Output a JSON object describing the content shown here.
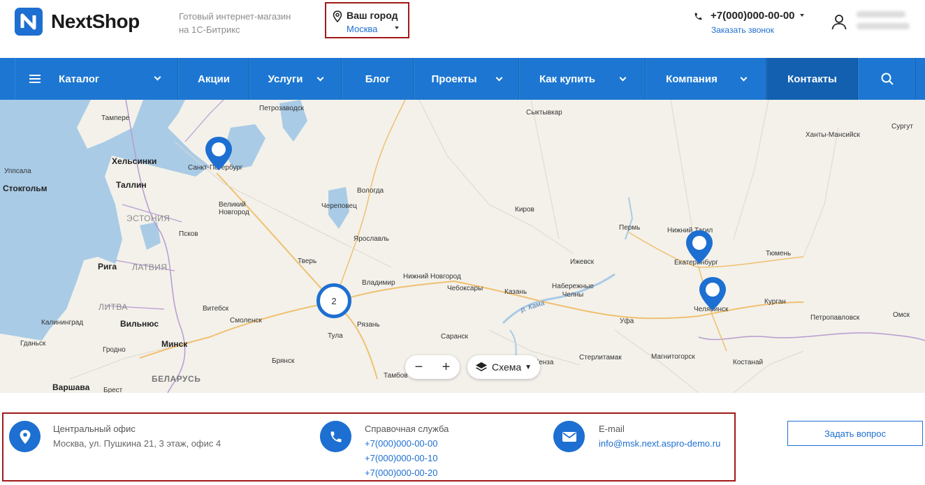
{
  "brand": {
    "name": "NextShop",
    "accent": "#1d6fd1"
  },
  "tagline": {
    "line1": "Готовый интернет-магазин",
    "line2": "на 1С-Битрикс"
  },
  "city": {
    "title": "Ваш город",
    "value": "Москва"
  },
  "phone": {
    "number": "+7(000)000-00-00",
    "callback": "Заказать звонок"
  },
  "nav": {
    "items": [
      {
        "label": "Каталог",
        "has_menu": true
      },
      {
        "label": "Акции"
      },
      {
        "label": "Услуги",
        "has_menu": true
      },
      {
        "label": "Блог"
      },
      {
        "label": "Проекты",
        "has_menu": true
      },
      {
        "label": "Как купить",
        "has_menu": true
      },
      {
        "label": "Компания",
        "has_menu": true
      },
      {
        "label": "Контакты",
        "active": true
      }
    ]
  },
  "map": {
    "cities": [
      "Петрозаводск",
      "Сыктывкар",
      "Тампере",
      "Ханты-Мансийск",
      "Сургут",
      "Хельсинки",
      "Санкт-Петербург",
      "Уппсала",
      "Стокгольм",
      "Таллин",
      "Вологда",
      "Череповец",
      "Великий Новгород",
      "Киров",
      "Пермь",
      "Нижний Тагил",
      "ЭСТОНИЯ",
      "Псков",
      "Ярославль",
      "Тюмень",
      "Рига",
      "ЛАТВИЯ",
      "Тверь",
      "Нижний Новгород",
      "Ижевск",
      "Екатеринбург",
      "Владимир",
      "Чебоксары",
      "Казань",
      "Набережные Челны",
      "ЛИТВА",
      "Витебск",
      "р. Кама",
      "Челябинск",
      "Курган",
      "Калининград",
      "Вильнюс",
      "Смоленск",
      "Рязань",
      "Уфа",
      "Петропавловск",
      "Омск",
      "Гданьск",
      "Минск",
      "Тула",
      "Саранск",
      "Гродно",
      "Брянск",
      "Стерлитамак",
      "Магнитогорск",
      "Костанай",
      "Варшава",
      "БЕЛАРУСЬ",
      "Тамбов",
      "Брест",
      "Пенза"
    ],
    "cluster_count": "2",
    "layer_label": "Схема",
    "zoom_out": "−",
    "zoom_in": "+"
  },
  "contacts": {
    "office": {
      "title": "Центральный офис",
      "address": "Москва, ул. Пушкина 21, 3 этаж, офис 4"
    },
    "support": {
      "title": "Справочная служба",
      "phones": [
        "+7(000)000-00-00",
        "+7(000)000-00-10",
        "+7(000)000-00-20"
      ]
    },
    "email": {
      "title": "E-mail",
      "value": "info@msk.next.aspro-demo.ru"
    },
    "ask_button": "Задать вопрос"
  }
}
